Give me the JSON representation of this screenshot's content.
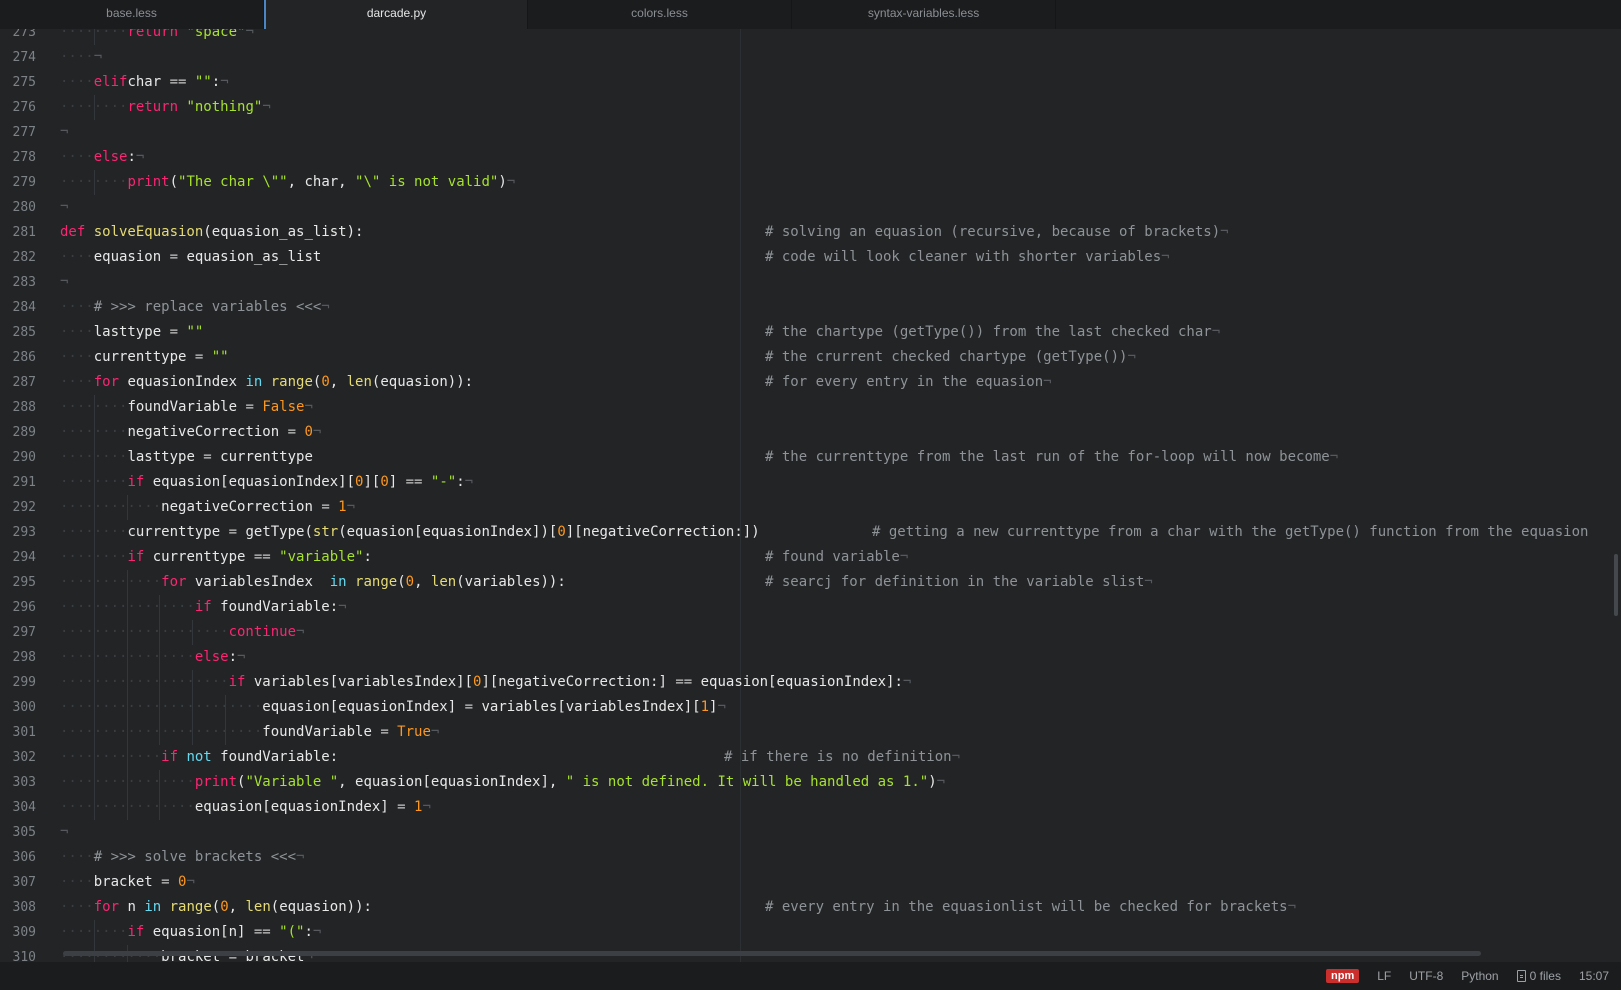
{
  "tabs": [
    "base.less",
    "darcade.py",
    "colors.less",
    "syntax-variables.less"
  ],
  "active_tab": "darcade.py",
  "eol_marker": "¬",
  "indent_marker": "····",
  "lines": [
    {
      "n": "273",
      "lvl": 2,
      "t": [
        [
          "k",
          "return"
        ],
        [
          "s",
          " \"space\""
        ]
      ]
    },
    {
      "n": "274",
      "lvl": 1,
      "t": []
    },
    {
      "n": "275",
      "lvl": 1,
      "t": [
        [
          "k",
          "elif"
        ],
        [
          "",
          "char "
        ],
        [
          "o",
          "=="
        ],
        [
          "s",
          " \"\""
        ],
        [
          "",
          ":"
        ]
      ]
    },
    {
      "n": "276",
      "lvl": 2,
      "t": [
        [
          "k",
          "return"
        ],
        [
          "s",
          " \"nothing\""
        ]
      ]
    },
    {
      "n": "277",
      "lvl": 0,
      "t": []
    },
    {
      "n": "278",
      "lvl": 1,
      "t": [
        [
          "k",
          "else"
        ],
        [
          "",
          ":"
        ]
      ]
    },
    {
      "n": "279",
      "lvl": 2,
      "t": [
        [
          "k",
          "print"
        ],
        [
          "",
          "("
        ],
        [
          "s",
          "\"The char \\\"\""
        ],
        [
          "",
          ", char, "
        ],
        [
          "s",
          "\"\\\" is not valid\""
        ],
        [
          "",
          ")"
        ]
      ]
    },
    {
      "n": "280",
      "lvl": 0,
      "t": []
    },
    {
      "n": "281",
      "lvl": 0,
      "t": [
        [
          "k",
          "def "
        ],
        [
          "f",
          "solveEquasion"
        ],
        [
          "",
          "(equasion_as_list):"
        ]
      ],
      "cmt": "# solving an equasion (recursive, because of brackets)"
    },
    {
      "n": "282",
      "lvl": 1,
      "t": [
        [
          "",
          "equasion "
        ],
        [
          "o",
          "="
        ],
        [
          "",
          "",
          " equasion_as_list"
        ]
      ],
      "cmt": "# code will look cleaner with shorter variables"
    },
    {
      "n": "283",
      "lvl": 0,
      "t": []
    },
    {
      "n": "284",
      "lvl": 1,
      "t": [
        [
          "c",
          "# >>> replace variables <<<"
        ]
      ]
    },
    {
      "n": "285",
      "lvl": 1,
      "t": [
        [
          "",
          "lasttype "
        ],
        [
          "o",
          "="
        ],
        [
          "s",
          " \"\""
        ]
      ],
      "cmt": "# the chartype (getType()) from the last checked char"
    },
    {
      "n": "286",
      "lvl": 1,
      "t": [
        [
          "",
          "currenttype "
        ],
        [
          "o",
          "="
        ],
        [
          "s",
          " \"\""
        ]
      ],
      "cmt": "# the crurrent checked chartype (getType())"
    },
    {
      "n": "287",
      "lvl": 1,
      "t": [
        [
          "k",
          "for"
        ],
        [
          "",
          " equasionIndex "
        ],
        [
          "b",
          "in"
        ],
        [
          "f",
          " range"
        ],
        [
          "",
          "("
        ],
        [
          "n",
          "0"
        ],
        [
          "",
          ", "
        ],
        [
          "f",
          "len"
        ],
        [
          "",
          "(equasion)):"
        ]
      ],
      "cmt": "# for every entry in the equasion"
    },
    {
      "n": "288",
      "lvl": 2,
      "t": [
        [
          "",
          "foundVariable "
        ],
        [
          "o",
          "="
        ],
        [
          "n",
          " False"
        ]
      ]
    },
    {
      "n": "289",
      "lvl": 2,
      "t": [
        [
          "",
          "negativeCorrection "
        ],
        [
          "o",
          "="
        ],
        [
          "n",
          " 0"
        ]
      ]
    },
    {
      "n": "290",
      "lvl": 2,
      "t": [
        [
          "",
          "lasttype "
        ],
        [
          "o",
          "="
        ],
        [
          "",
          " currenttype"
        ]
      ],
      "cmt": "# the currenttype from the last run of the for-loop will now become"
    },
    {
      "n": "291",
      "lvl": 2,
      "t": [
        [
          "k",
          "if"
        ],
        [
          "",
          " equasion[equasionIndex]["
        ],
        [
          "n",
          "0"
        ],
        [
          "",
          "]["
        ],
        [
          "n",
          "0"
        ],
        [
          "",
          "] "
        ],
        [
          "o",
          "=="
        ],
        [
          "s",
          " \"-\""
        ],
        [
          "",
          ":"
        ]
      ]
    },
    {
      "n": "292",
      "lvl": 3,
      "t": [
        [
          "",
          "negativeCorrection "
        ],
        [
          "o",
          "="
        ],
        [
          "n",
          " 1"
        ]
      ]
    },
    {
      "n": "293",
      "lvl": 2,
      "t": [
        [
          "",
          "currenttype "
        ],
        [
          "o",
          "="
        ],
        [
          "",
          " getType("
        ],
        [
          "f",
          "str"
        ],
        [
          "",
          "(equasion[equasionIndex])["
        ],
        [
          "n",
          "0"
        ],
        [
          "",
          "][negativeCorrection:])"
        ]
      ],
      "cmt": "# getting a new currenttype from a char with the getType() function from the equasion",
      "cmtWide": true
    },
    {
      "n": "294",
      "lvl": 2,
      "t": [
        [
          "k",
          "if"
        ],
        [
          "",
          " currenttype "
        ],
        [
          "o",
          "=="
        ],
        [
          "s",
          " \"variable\""
        ],
        [
          "",
          ":"
        ]
      ],
      "cmt": "# found variable"
    },
    {
      "n": "295",
      "lvl": 3,
      "t": [
        [
          "k",
          "for"
        ],
        [
          "",
          " variablesIndex  "
        ],
        [
          "b",
          "in"
        ],
        [
          "f",
          " range"
        ],
        [
          "",
          "("
        ],
        [
          "n",
          "0"
        ],
        [
          "",
          ", "
        ],
        [
          "f",
          "len"
        ],
        [
          "",
          "(variables)):"
        ]
      ],
      "cmt": "# searcj for definition in the variable slist"
    },
    {
      "n": "296",
      "lvl": 4,
      "t": [
        [
          "k",
          "if"
        ],
        [
          "",
          " foundVariable:"
        ]
      ]
    },
    {
      "n": "297",
      "lvl": 5,
      "t": [
        [
          "k",
          "continue"
        ]
      ]
    },
    {
      "n": "298",
      "lvl": 4,
      "t": [
        [
          "k",
          "else"
        ],
        [
          "",
          ":"
        ]
      ]
    },
    {
      "n": "299",
      "lvl": 5,
      "t": [
        [
          "k",
          "if"
        ],
        [
          "",
          " variables[variablesIndex]["
        ],
        [
          "n",
          "0"
        ],
        [
          "",
          "][negativeCorrection:] "
        ],
        [
          "o",
          "=="
        ],
        [
          "",
          " equasion[equasionIndex]:"
        ]
      ]
    },
    {
      "n": "300",
      "lvl": 6,
      "t": [
        [
          "",
          "equasion[equasionIndex] "
        ],
        [
          "o",
          "="
        ],
        [
          "",
          " variables[variablesIndex]["
        ],
        [
          "n",
          "1"
        ],
        [
          "",
          "]"
        ]
      ]
    },
    {
      "n": "301",
      "lvl": 6,
      "t": [
        [
          "",
          "foundVariable "
        ],
        [
          "o",
          "="
        ],
        [
          "n",
          " True"
        ]
      ]
    },
    {
      "n": "302",
      "lvl": 3,
      "t": [
        [
          "k",
          "if"
        ],
        [
          "b",
          " not"
        ],
        [
          "",
          " foundVariable:"
        ]
      ],
      "cmt": "# if there is no definition",
      "cmtNarrow": true
    },
    {
      "n": "303",
      "lvl": 4,
      "t": [
        [
          "k",
          "print"
        ],
        [
          "",
          "("
        ],
        [
          "s",
          "\"Variable \""
        ],
        [
          "",
          ", equasion[equasionIndex], "
        ],
        [
          "s",
          "\" is not defined. It will be handled as 1.\""
        ],
        [
          "",
          ")"
        ]
      ]
    },
    {
      "n": "304",
      "lvl": 4,
      "t": [
        [
          "",
          "equasion[equasionIndex] "
        ],
        [
          "o",
          "="
        ],
        [
          "n",
          " 1"
        ]
      ]
    },
    {
      "n": "305",
      "lvl": 0,
      "t": []
    },
    {
      "n": "306",
      "lvl": 1,
      "t": [
        [
          "c",
          "# >>> solve brackets <<<"
        ]
      ]
    },
    {
      "n": "307",
      "lvl": 1,
      "t": [
        [
          "",
          "bracket "
        ],
        [
          "o",
          "="
        ],
        [
          "n",
          " 0"
        ]
      ]
    },
    {
      "n": "308",
      "lvl": 1,
      "t": [
        [
          "k",
          "for"
        ],
        [
          "",
          " n "
        ],
        [
          "b",
          "in"
        ],
        [
          "f",
          " range"
        ],
        [
          "",
          "("
        ],
        [
          "n",
          "0"
        ],
        [
          "",
          ", "
        ],
        [
          "f",
          "len"
        ],
        [
          "",
          "(equasion)):"
        ]
      ],
      "cmt": "# every entry in the equasionlist will be checked for brackets"
    },
    {
      "n": "309",
      "lvl": 2,
      "t": [
        [
          "k",
          "if"
        ],
        [
          "",
          " equasion[n] "
        ],
        [
          "o",
          "=="
        ],
        [
          "s",
          " \"(\""
        ],
        [
          "",
          ":"
        ]
      ]
    },
    {
      "n": "310",
      "lvl": 3,
      "t": [
        [
          "",
          "bracket "
        ],
        [
          "o",
          "="
        ],
        [
          "",
          " bracket"
        ]
      ]
    }
  ],
  "status": {
    "npm": "npm",
    "line_ending": "LF",
    "encoding": "UTF-8",
    "grammar": "Python",
    "files": "0 files",
    "time": "15:07"
  }
}
